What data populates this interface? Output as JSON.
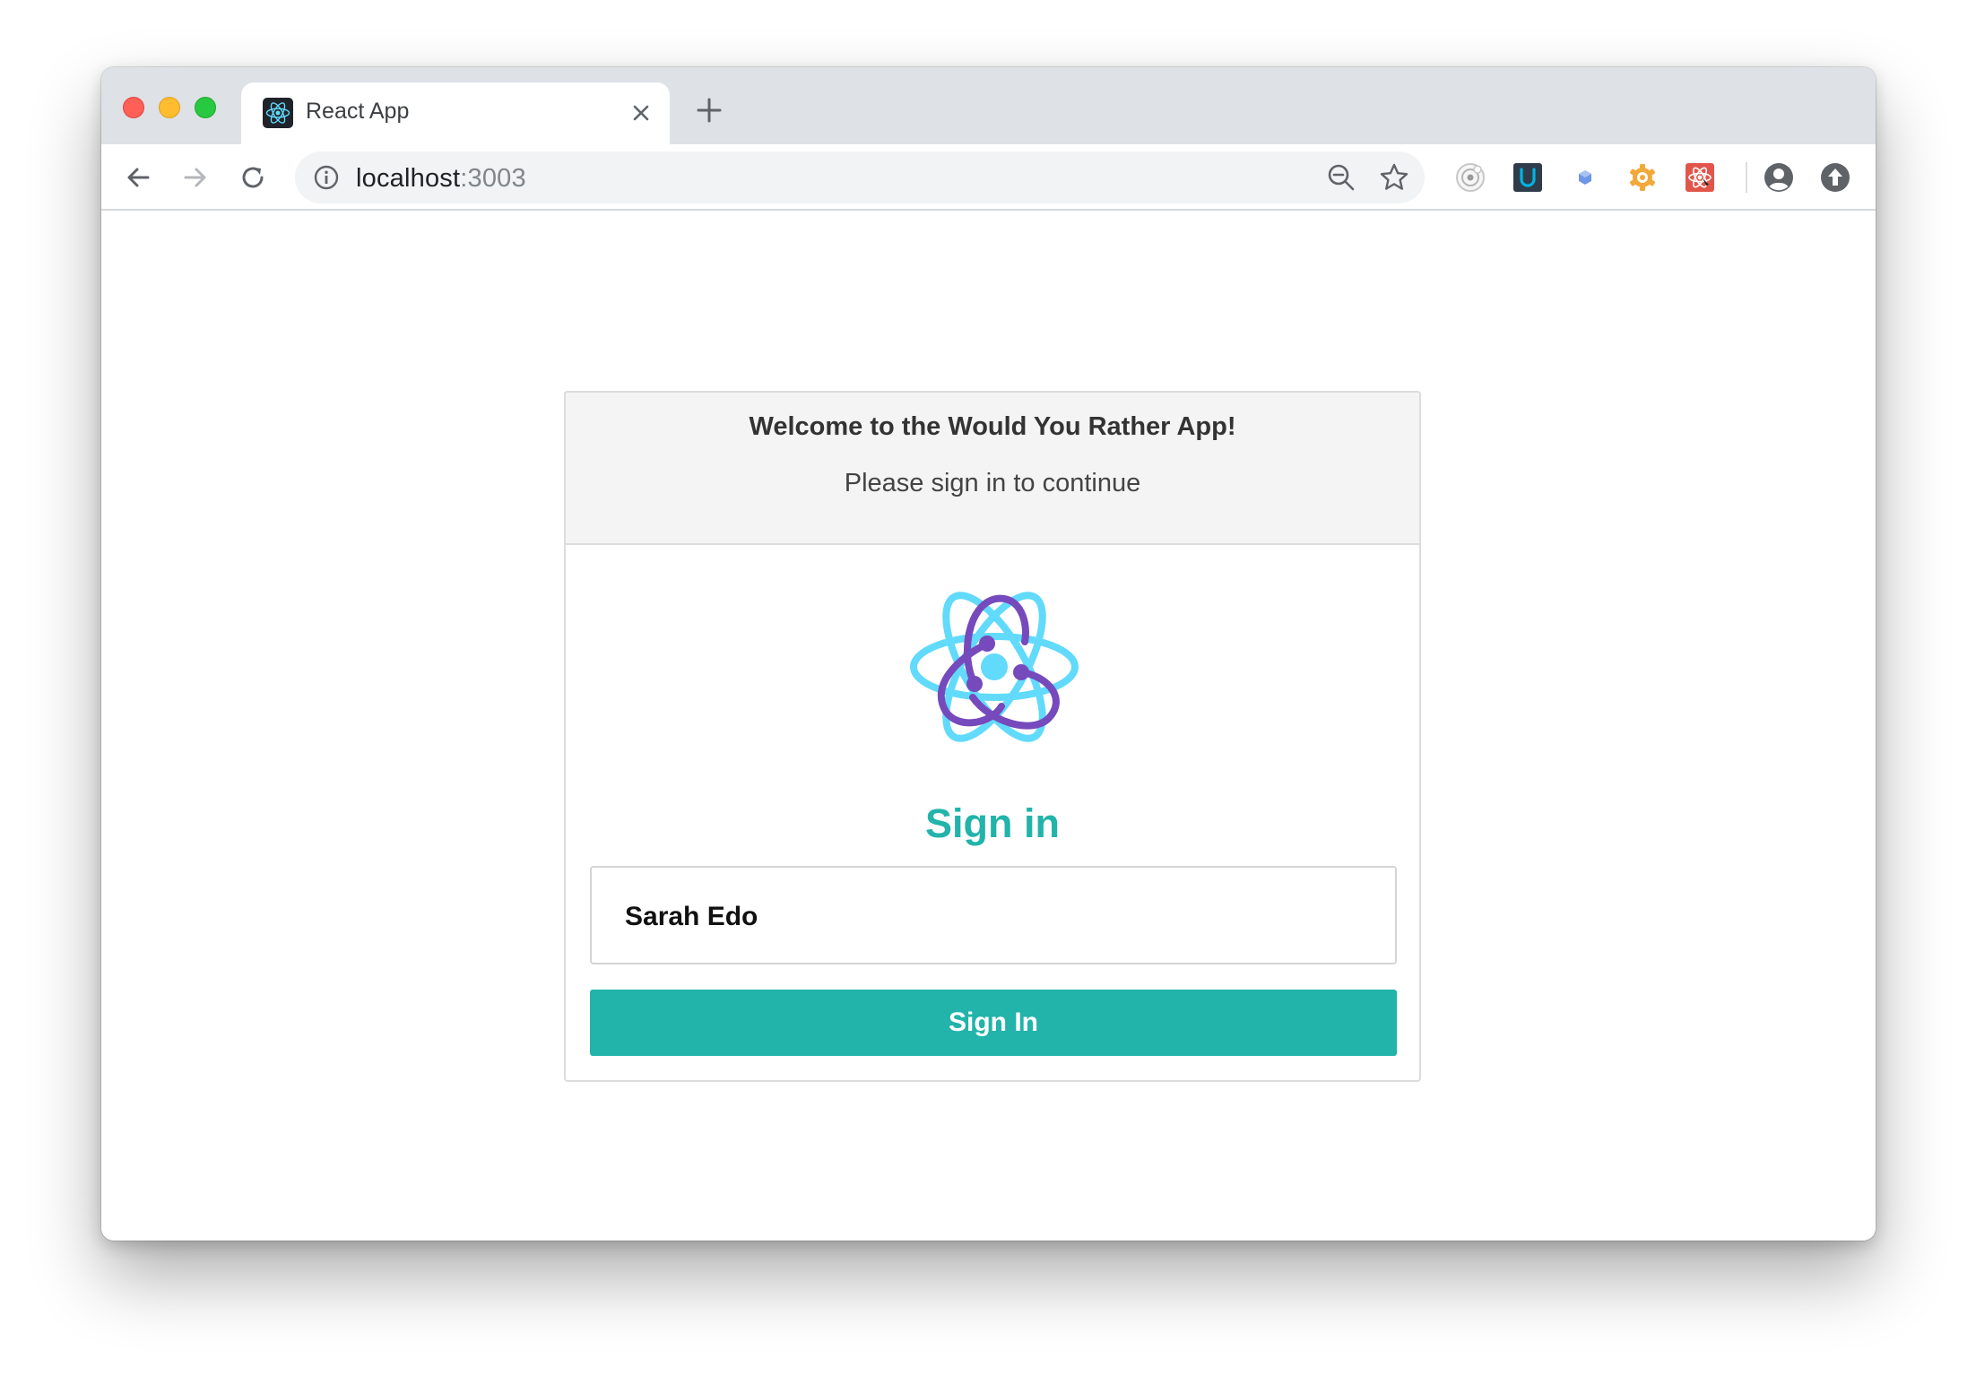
{
  "browser": {
    "tab_title": "React App",
    "url_host": "localhost",
    "url_port": ":3003"
  },
  "extensions": [
    "target-icon",
    "u-badge-icon",
    "hexagon-icon",
    "gear-badge-icon",
    "react-devtools-icon"
  ],
  "header": {
    "welcome": "Welcome to the Would You Rather App!",
    "subtitle": "Please sign in to continue"
  },
  "signin": {
    "heading": "Sign in",
    "selected_user": "Sarah Edo",
    "button_label": "Sign In"
  },
  "colors": {
    "accent": "#22b3aa",
    "react_blue": "#61dafb",
    "redux_purple": "#764abc"
  }
}
